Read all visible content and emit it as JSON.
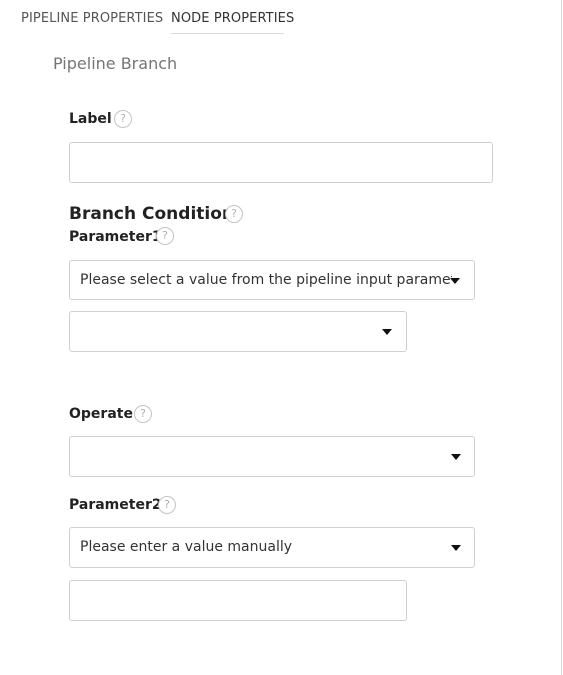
{
  "tabs": {
    "pipeline_label": "PIPELINE PROPERTIES",
    "node_label": "NODE PROPERTIES"
  },
  "section_title": "Pipeline Branch",
  "label_field": {
    "label": "Label",
    "value": ""
  },
  "branch_condition": {
    "heading": "Branch Condition",
    "parameter1": {
      "label": "Parameter1",
      "source_selected": "Please select a value from the pipeline input parameters",
      "value_selected": ""
    },
    "operate": {
      "label": "Operate",
      "selected": ""
    },
    "parameter2": {
      "label": "Parameter2",
      "source_selected": "Please enter a value manually",
      "value": ""
    }
  },
  "help_glyph": "?",
  "icons": {
    "help": "question-circle-icon",
    "dropdown": "caret-down-icon"
  },
  "colors": {
    "border": "#cfcfcf",
    "muted_text": "#757575",
    "help_border": "#c4c4c4"
  }
}
